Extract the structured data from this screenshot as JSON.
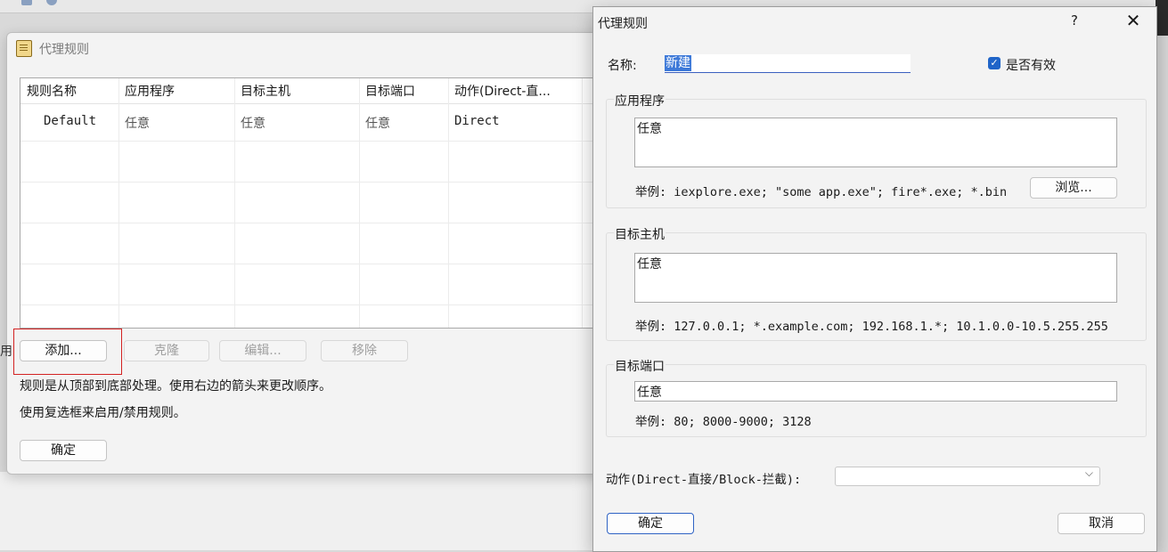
{
  "back_dialog": {
    "title": "代理规则",
    "columns": [
      "规则名称",
      "应用程序",
      "目标主机",
      "目标端口",
      "动作(Direct-直..."
    ],
    "rows": [
      [
        "Default",
        "任意",
        "任意",
        "任意",
        "Direct"
      ]
    ],
    "buttons": {
      "add": "添加...",
      "clone": "克隆",
      "edit": "编辑...",
      "remove": "移除",
      "ok": "确定"
    },
    "notes": [
      "规则是从顶部到底部处理。使用右边的箭头来更改顺序。",
      "使用复选框来启用/禁用规则。"
    ],
    "side_label": "用"
  },
  "edit_dialog": {
    "title": "代理规则",
    "help_label": "?",
    "close_label": "✕",
    "name_label": "名称:",
    "name_value": "新建",
    "enabled_label": "是否有效",
    "enabled": true,
    "app_group": {
      "title": "应用程序",
      "value": "任意",
      "example": "举例: iexplore.exe; \"some app.exe\"; fire*.exe; *.bin",
      "browse_label": "浏览..."
    },
    "host_group": {
      "title": "目标主机",
      "value": "任意",
      "example": "举例: 127.0.0.1; *.example.com; 192.168.1.*; 10.1.0.0-10.5.255.255"
    },
    "port_group": {
      "title": "目标端口",
      "value": "任意",
      "example": "举例: 80; 8000-9000; 3128"
    },
    "action_label": "动作(Direct-直接/Block-拦截):",
    "action_value": "",
    "ok_label": "确定",
    "cancel_label": "取消"
  },
  "colors": {
    "accent": "#1f64c8",
    "selection": "#3d79d8",
    "highlight_box": "#d32222"
  }
}
